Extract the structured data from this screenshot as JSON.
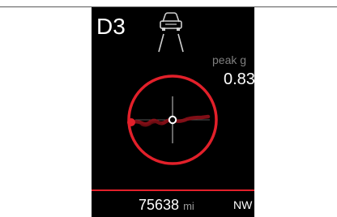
{
  "display": {
    "gear": "D3",
    "peak_g_label": "peak g",
    "peak_g_value": "0.83",
    "odometer_value": "75638",
    "odometer_unit": "mi",
    "heading": "NW"
  },
  "icons": {
    "car": "car-front-lane-icon"
  },
  "colors": {
    "screen_background": "#000000",
    "accent_red": "#e2202a",
    "trail_dark_red": "#8e1018",
    "label_gray": "#7f7f7f",
    "text_white": "#ffffff"
  }
}
